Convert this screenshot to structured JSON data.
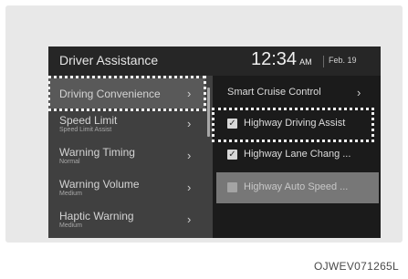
{
  "header": {
    "title": "Driver Assistance",
    "time": "12:34",
    "ampm": "AM",
    "date": "Feb. 19"
  },
  "menu": [
    {
      "label": "Driving Convenience",
      "sub": "",
      "selected": true
    },
    {
      "label": "Speed Limit",
      "sub": "Speed Limit Assist"
    },
    {
      "label": "Warning Timing",
      "sub": "Normal"
    },
    {
      "label": "Warning Volume",
      "sub": "Medium"
    },
    {
      "label": "Haptic Warning",
      "sub": "Medium"
    }
  ],
  "submenu": [
    {
      "label": "Smart Cruise Control",
      "type": "link"
    },
    {
      "label": "Highway Driving Assist",
      "type": "checkbox",
      "checked": true,
      "focused": true
    },
    {
      "label": "Highway Lane Chang ...",
      "type": "checkbox",
      "checked": true
    },
    {
      "label": "Highway Auto Speed ...",
      "type": "checkbox",
      "checked": false,
      "disabled": true
    }
  ],
  "icons": {
    "chevron": "chevron-right-icon",
    "check": "check-icon"
  },
  "caption": "OJWEV071265L"
}
